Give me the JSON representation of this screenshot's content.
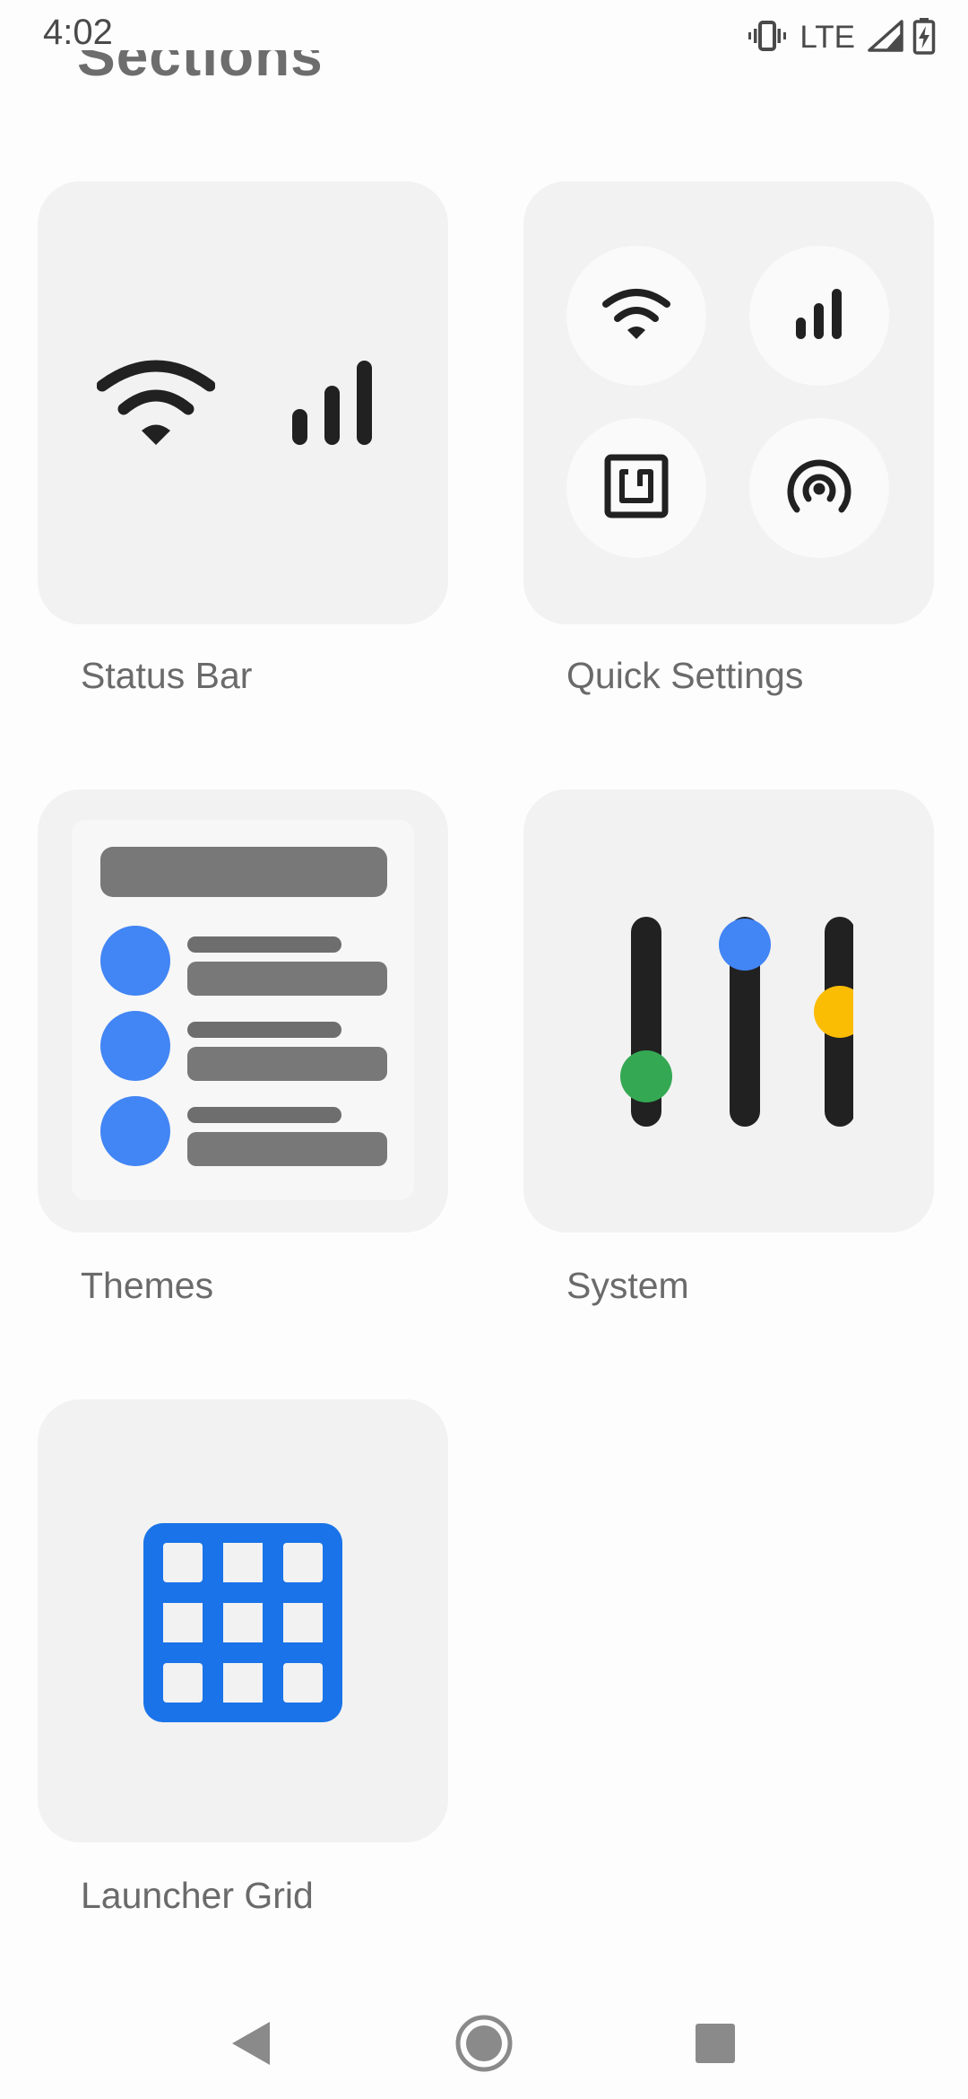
{
  "status_bar": {
    "time": "4:02",
    "network": "LTE",
    "icons": [
      "vibrate-icon",
      "signal-icon",
      "battery-charging-icon"
    ]
  },
  "page": {
    "title": "Sections"
  },
  "sections": [
    {
      "label": "Status Bar",
      "icons": [
        "wifi-icon",
        "cellular-signal-icon"
      ]
    },
    {
      "label": "Quick Settings",
      "icons": [
        "wifi-icon",
        "cellular-signal-icon",
        "nfc-icon",
        "hotspot-icon"
      ]
    },
    {
      "label": "Themes",
      "icons": [
        "theme-preview-icon"
      ]
    },
    {
      "label": "System",
      "icons": [
        "sliders-icon"
      ]
    },
    {
      "label": "Launcher Grid",
      "icons": [
        "grid-icon"
      ]
    }
  ],
  "nav": {
    "icons": [
      "back-icon",
      "home-icon",
      "recents-icon"
    ]
  },
  "colors": {
    "card_bg": "#f2f2f2",
    "blue": "#4285f4",
    "grid_blue": "#1a73e8",
    "green": "#34a853",
    "yellow": "#fbbc04",
    "icon_dark": "#212121"
  }
}
